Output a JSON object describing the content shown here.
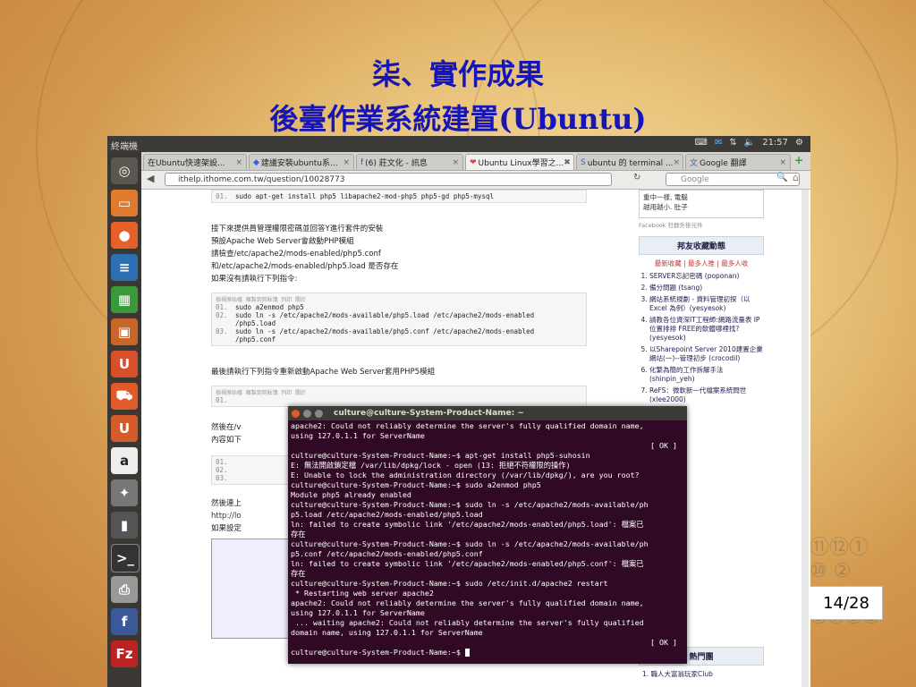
{
  "slide": {
    "title1": "柒、實作成果",
    "title2": "後臺作業系統建置(Ubuntu)",
    "page": "14/28"
  },
  "system": {
    "app_title": "終端機",
    "clock": "21:57"
  },
  "tabs": [
    {
      "label": "在Ubuntu快速架設...",
      "active": false
    },
    {
      "label": "建議安裝ubuntu系...",
      "active": false
    },
    {
      "label": "(6) 莊文化 - 訊息",
      "active": false
    },
    {
      "label": "Ubuntu Linux學習之...",
      "active": true
    },
    {
      "label": "ubuntu 的 terminal ...",
      "active": false
    },
    {
      "label": "Google 翻譯",
      "active": false
    }
  ],
  "nav": {
    "url": "ithelp.ithome.com.tw/question/10028773",
    "search_placeholder": "Google"
  },
  "article": {
    "code1": {
      "lines": [
        {
          "n": "01.",
          "t": "sudo apt-get install php5 libapache2-mod-php5 php5-gd php5-mysql"
        }
      ]
    },
    "para1": "接下來提供員管理權限密碼並回答Y進行套件的安裝",
    "para2": "預設Apache Web Server會啟動PHP模組",
    "para3": "請檢查/etc/apache2/mods-enabled/php5.conf",
    "para4": "和/etc/apache2/mods-enabled/php5.load 是否存在",
    "para5": "如果沒有請執行下列指令:",
    "code2": {
      "head": "檢視原始檔  複製到剪貼簿  列印  關於",
      "lines": [
        {
          "n": "01.",
          "t": "sudo a2enmod php5"
        },
        {
          "n": "02.",
          "t": "sudo ln -s /etc/apache2/mods-available/php5.load /etc/apache2/mods-enabled"
        },
        {
          "n": "",
          "t": "/php5.load"
        },
        {
          "n": "03.",
          "t": "sudo ln -s /etc/apache2/mods-available/php5.conf /etc/apache2/mods-enabled"
        },
        {
          "n": "",
          "t": "/php5.conf"
        }
      ]
    },
    "para6": "最後請執行下列指令重新啟動Apache Web Server套用PHP5模組",
    "code3_head": "檢視原始檔  複製到剪貼簿  列印  關於",
    "code3_n": "01.",
    "para7": "然後在/v",
    "para8": "內容如下",
    "code4": [
      {
        "n": "01."
      },
      {
        "n": "02."
      },
      {
        "n": "03."
      }
    ],
    "para9": "然後連上",
    "para10": "http://lo",
    "para11": "如果設定"
  },
  "sidebar": {
    "fb_text1": "重中一樣, 電腦",
    "fb_text2": "越用越小. 肚子",
    "fb_footer": "Facebook 社群外掛元件",
    "panel_title": "邦友收藏動態",
    "filters": "最新收藏 | 最多人推 | 最多人收",
    "items": [
      {
        "t": "SERVER忘記密碼 (poponan)"
      },
      {
        "t": "備分問題 (tsang)"
      },
      {
        "t": "網站系統規劃 - 資料管理初探（以 Excel 為例）(yesyesok)"
      },
      {
        "t": "請教各位資深IT工程師:網路流量表 IP位置排排 FREE的軟體哪裡找? (yesyesok)"
      },
      {
        "t": "以Sharepoint Server 2010建置企業網站(一)--管理初步 (crocodil)"
      },
      {
        "t": "化繁為簡的工作拆解手法 (shinpin_yeh)"
      },
      {
        "t": "ReFS：微軟新一代檔案系統問世 (xlee2000)"
      }
    ],
    "panel2_title": "熱門團",
    "panel2_item": "1. 職人大富翁玩家Club"
  },
  "terminal": {
    "title": "culture@culture-System-Product-Name: ~",
    "lines": [
      "apache2: Could not reliably determine the server's fully qualified domain name,",
      "using 127.0.1.1 for ServerName",
      "[ OK ]",
      "culture@culture-System-Product-Name:~$ apt-get install php5-suhosin",
      "E: 無法開啟鎖定檔 /var/lib/dpkg/lock - open (13: 拒絕不符權限的操作)",
      "E: Unable to lock the administration directory (/var/lib/dpkg/), are you root?",
      "culture@culture-System-Product-Name:~$ sudo a2enmod php5",
      "Module php5 already enabled",
      "culture@culture-System-Product-Name:~$ sudo ln -s /etc/apache2/mods-available/ph",
      "p5.load /etc/apache2/mods-enabled/php5.load",
      "ln: failed to create symbolic link '/etc/apache2/mods-enabled/php5.load': 檔案已",
      "存在",
      "culture@culture-System-Product-Name:~$ sudo ln -s /etc/apache2/mods-available/ph",
      "p5.conf /etc/apache2/mods-enabled/php5.conf",
      "ln: failed to create symbolic link '/etc/apache2/mods-enabled/php5.conf': 檔案已",
      "存在",
      "culture@culture-System-Product-Name:~$ sudo /etc/init.d/apache2 restart",
      " * Restarting web server apache2",
      "apache2: Could not reliably determine the server's fully qualified domain name,",
      "using 127.0.1.1 for ServerName",
      " ... waiting apache2: Could not reliably determine the server's fully qualified",
      "domain name, using 127.0.1.1 for ServerName",
      "[ OK ]",
      "culture@culture-System-Product-Name:~$ "
    ]
  }
}
